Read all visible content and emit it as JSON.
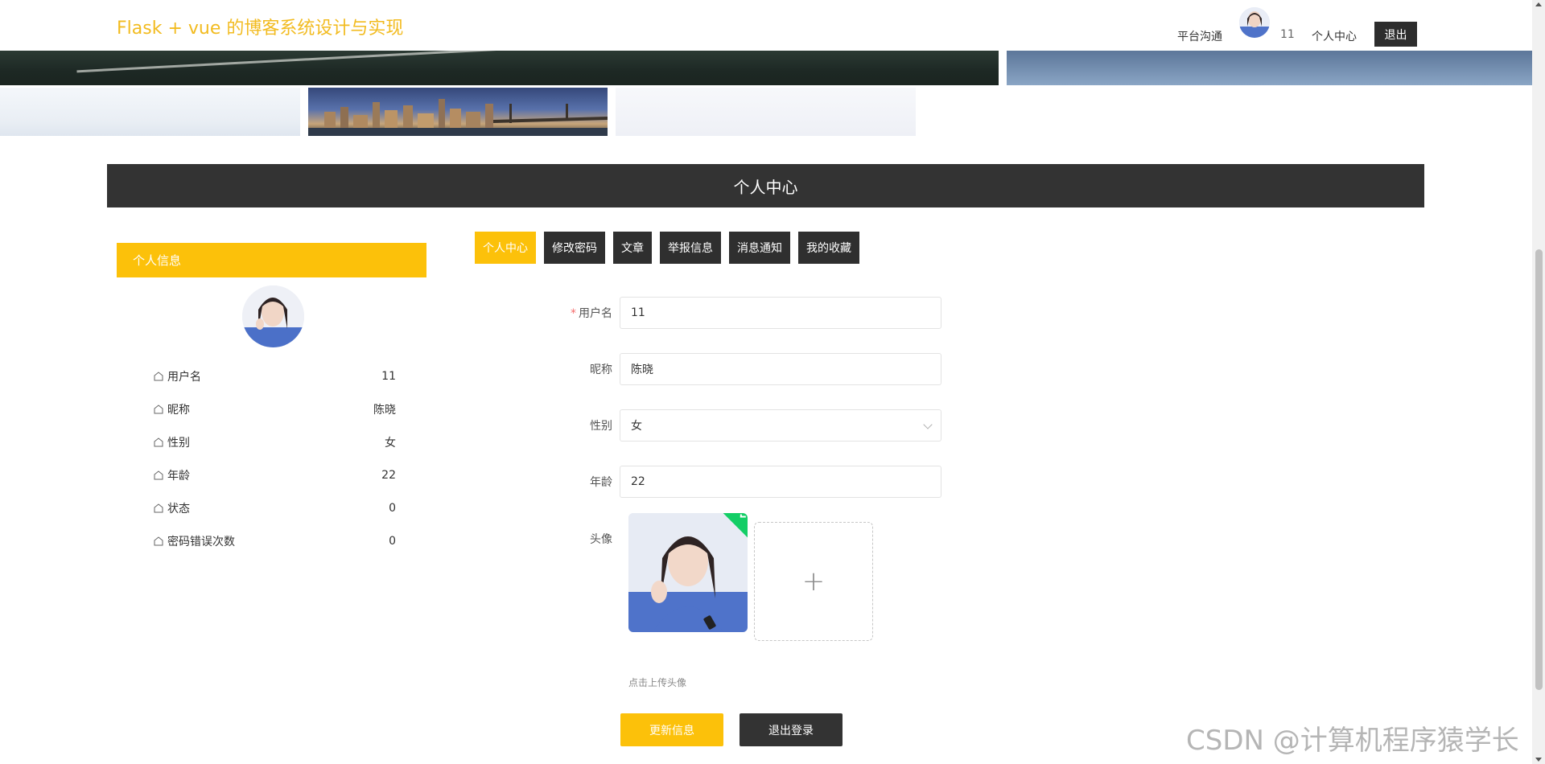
{
  "header": {
    "site_title": "Flask + vue 的博客系统设计与实现",
    "nav_chat": "平台沟通",
    "nav_username": "11",
    "nav_personal_center": "个人中心",
    "logout_button": "退出"
  },
  "section": {
    "title": "个人中心"
  },
  "info_panel": {
    "header": "个人信息",
    "rows": [
      {
        "label": "用户名",
        "value": "11"
      },
      {
        "label": "昵称",
        "value": "陈晓"
      },
      {
        "label": "性别",
        "value": "女"
      },
      {
        "label": "年龄",
        "value": "22"
      },
      {
        "label": "状态",
        "value": "0"
      },
      {
        "label": "密码错误次数",
        "value": "0"
      }
    ]
  },
  "tabs": [
    {
      "label": "个人中心",
      "active": true
    },
    {
      "label": "修改密码",
      "active": false
    },
    {
      "label": "文章",
      "active": false
    },
    {
      "label": "举报信息",
      "active": false
    },
    {
      "label": "消息通知",
      "active": false
    },
    {
      "label": "我的收藏",
      "active": false
    }
  ],
  "form": {
    "username": {
      "label": "用户名",
      "required_mark": "*",
      "value": "11"
    },
    "nickname": {
      "label": "昵称",
      "value": "陈晓"
    },
    "gender": {
      "label": "性别",
      "value": "女"
    },
    "age": {
      "label": "年龄",
      "value": "22"
    },
    "avatar": {
      "label": "头像",
      "add_symbol": "+",
      "tip": "点击上传头像"
    }
  },
  "actions": {
    "update": "更新信息",
    "logout": "退出登录"
  },
  "watermark": "CSDN @计算机程序猿学长",
  "colors": {
    "accent": "#fcc10a",
    "title": "#f2bb1f",
    "dark": "#333333",
    "success": "#13ce66"
  }
}
